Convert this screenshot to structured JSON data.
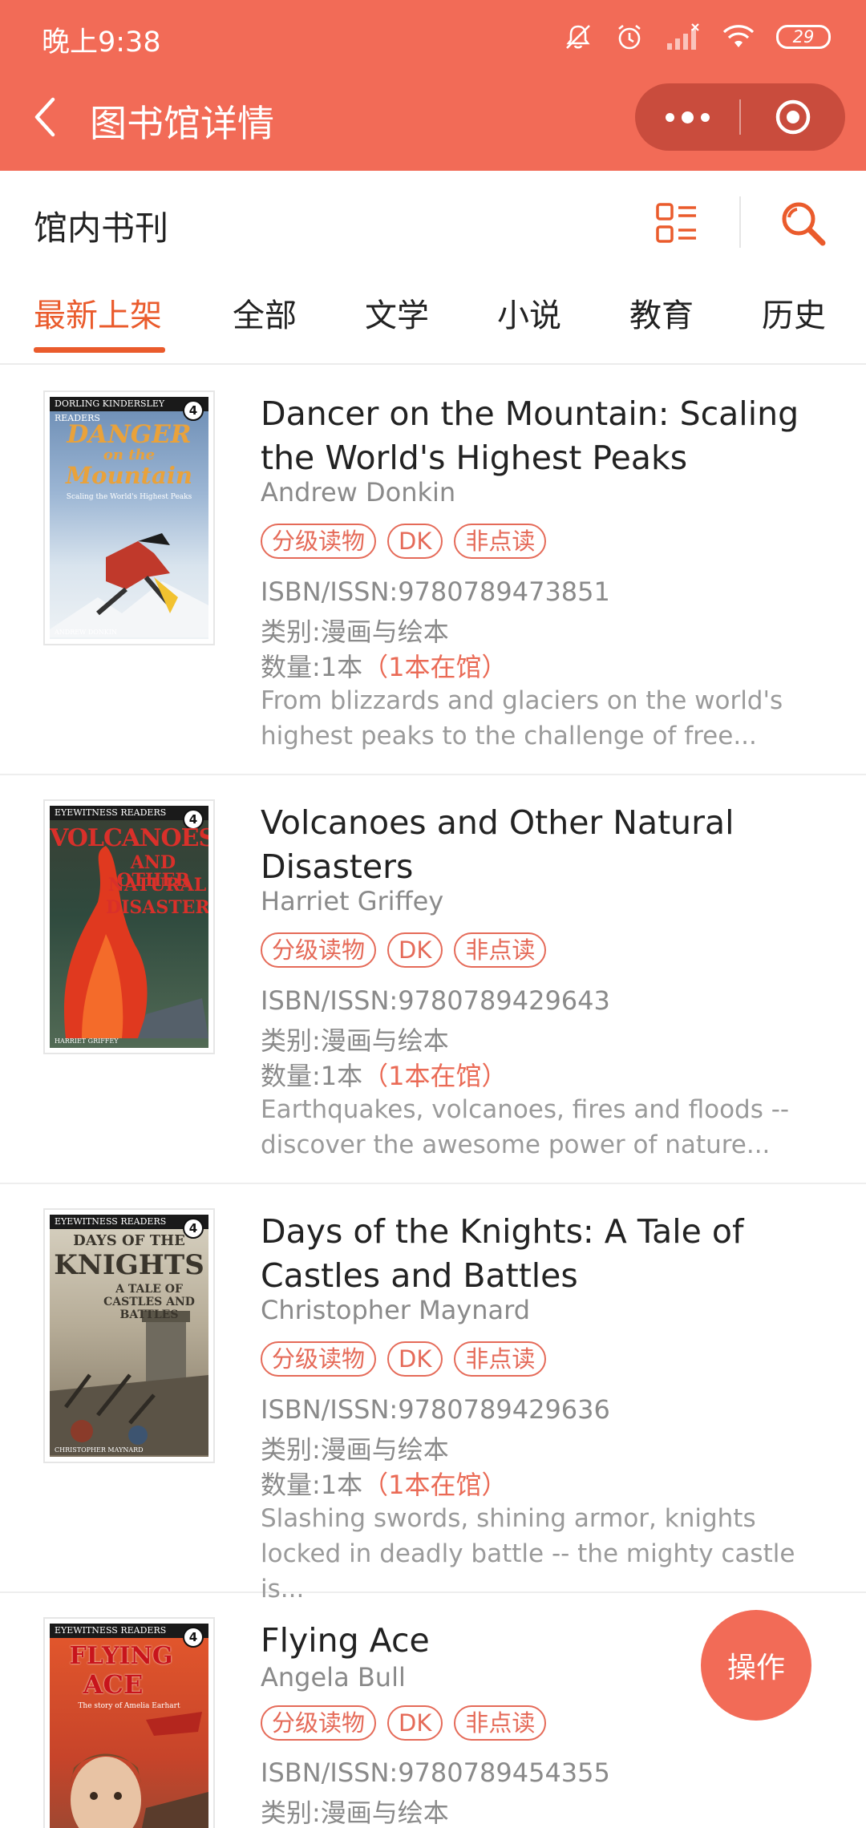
{
  "status_bar": {
    "time": "晚上9:38",
    "battery": "29"
  },
  "nav": {
    "title": "图书馆详情"
  },
  "section": {
    "title": "馆内书刊"
  },
  "tabs": [
    {
      "label": "最新上架",
      "active": true
    },
    {
      "label": "全部",
      "active": false
    },
    {
      "label": "文学",
      "active": false
    },
    {
      "label": "小说",
      "active": false
    },
    {
      "label": "教育",
      "active": false
    },
    {
      "label": "历史",
      "active": false
    }
  ],
  "books": [
    {
      "title": "Dancer on the Mountain: Scaling the World's Highest Peaks",
      "author": "Andrew Donkin",
      "tags": [
        "分级读物",
        "DK",
        "非点读"
      ],
      "isbn": "ISBN/ISSN:9780789473851",
      "category": "类别:漫画与绘本",
      "quantity": "数量:1本",
      "availability": "（1本在馆）",
      "description_lines": [
        "From blizzards and glaciers on the world's",
        "highest peaks to the challenge of free..."
      ],
      "cover": {
        "brand": "DORLING KINDERSLEY READERS",
        "level": "4",
        "title_lines": [
          "DANGER",
          "on the",
          "Mountain"
        ],
        "subtitle": "Scaling the World's Highest Peaks",
        "author": "ANDREW DONKIN"
      }
    },
    {
      "title": "Volcanoes and Other Natural Disasters",
      "author": "Harriet Griffey",
      "tags": [
        "分级读物",
        "DK",
        "非点读"
      ],
      "isbn": "ISBN/ISSN:9780789429643",
      "category": "类别:漫画与绘本",
      "quantity": "数量:1本",
      "availability": "（1本在馆）",
      "description_lines": [
        "Earthquakes, volcanoes, fires and floods --",
        "discover the awesome power of nature..."
      ],
      "cover": {
        "brand": "EYEWITNESS READERS",
        "level": "4",
        "title_lines": [
          "VOLCANOES",
          "AND OTHER",
          "NATURAL",
          "DISASTERS"
        ],
        "author": "HARRIET GRIFFEY"
      }
    },
    {
      "title": "Days of the Knights: A Tale of Castles and Battles",
      "author": "Christopher Maynard",
      "tags": [
        "分级读物",
        "DK",
        "非点读"
      ],
      "isbn": "ISBN/ISSN:9780789429636",
      "category": "类别:漫画与绘本",
      "quantity": "数量:1本",
      "availability": "（1本在馆）",
      "description_lines": [
        "Slashing swords, shining armor, knights",
        "locked in deadly battle -- the mighty castle is..."
      ],
      "cover": {
        "brand": "EYEWITNESS READERS",
        "level": "4",
        "title_lines": [
          "DAYS OF THE",
          "KNIGHTS",
          "A TALE OF",
          "CASTLES AND",
          "BATTLES"
        ],
        "author": "CHRISTOPHER MAYNARD"
      }
    },
    {
      "title": "Flying Ace",
      "author": "Angela Bull",
      "tags": [
        "分级读物",
        "DK",
        "非点读"
      ],
      "isbn": "ISBN/ISSN:9780789454355",
      "category": "类别:漫画与绘本",
      "cover": {
        "brand": "EYEWITNESS READERS",
        "level": "4",
        "title_lines": [
          "FLYING",
          "ACE"
        ],
        "subtitle": "The story of Amelia Earhart"
      }
    }
  ],
  "fab": {
    "label": "操作"
  },
  "colors": {
    "header": "#F26B57",
    "accent": "#EA5B2C",
    "tag": "#E56A58"
  },
  "icons": [
    "back-arrow-icon",
    "more-dots-icon",
    "home-target-icon",
    "grid-list-icon",
    "search-icon",
    "mute-icon",
    "alarm-icon",
    "signal-icon",
    "wifi-icon",
    "battery-icon"
  ]
}
